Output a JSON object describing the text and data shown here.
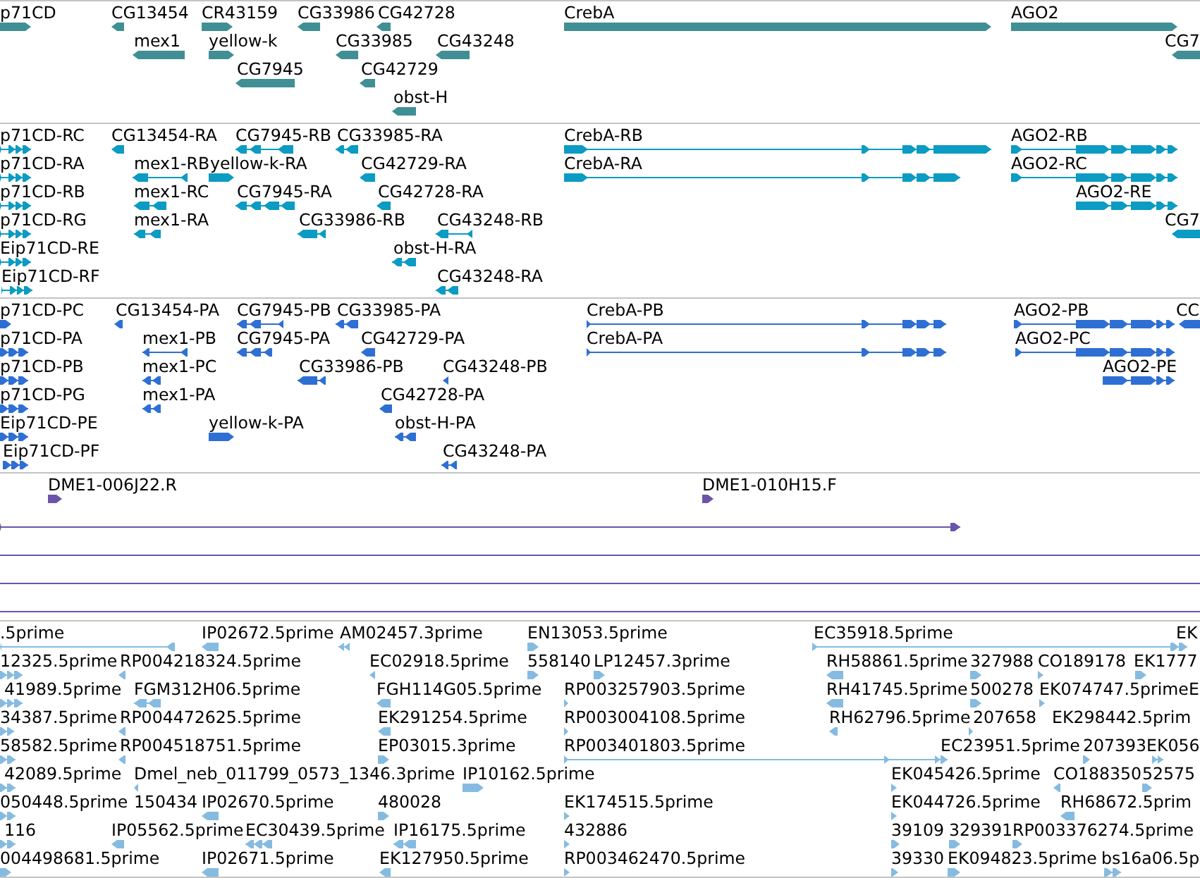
{
  "tracks": [
    {
      "kind": "gene",
      "features": [
        {
          "label": "p71CD",
          "reverse": false
        },
        {
          "label": "CG13454",
          "reverse": true
        },
        {
          "label": "CR43159",
          "reverse": false
        },
        {
          "label": "CG33986",
          "reverse": true
        },
        {
          "label": "CG42728",
          "reverse": true
        },
        {
          "label": "CrebA",
          "reverse": false
        },
        {
          "label": "AGO2",
          "reverse": false
        },
        {
          "label": "mex1",
          "reverse": true
        },
        {
          "label": "yellow-k",
          "reverse": false
        },
        {
          "label": "CG33985",
          "reverse": true
        },
        {
          "label": "CG43248",
          "reverse": true
        },
        {
          "label": "CG7",
          "reverse": true
        },
        {
          "label": "CG7945",
          "reverse": true
        },
        {
          "label": "CG42729",
          "reverse": true
        },
        {
          "label": "obst-H",
          "reverse": true
        }
      ]
    },
    {
      "kind": "transcript",
      "features": [
        {
          "label": "p71CD-RC",
          "reverse": false
        },
        {
          "label": "CG13454-RA",
          "reverse": true
        },
        {
          "label": "CG7945-RB",
          "reverse": true
        },
        {
          "label": "CG33985-RA",
          "reverse": true
        },
        {
          "label": "CrebA-RB",
          "reverse": false
        },
        {
          "label": "AGO2-RB",
          "reverse": false
        },
        {
          "label": "p71CD-RA",
          "reverse": false
        },
        {
          "label": "mex1-RB",
          "reverse": true
        },
        {
          "label": "yellow-k-RA",
          "reverse": false
        },
        {
          "label": "CG42729-RA",
          "reverse": true
        },
        {
          "label": "CrebA-RA",
          "reverse": false
        },
        {
          "label": "AGO2-RC",
          "reverse": false
        },
        {
          "label": "p71CD-RB",
          "reverse": false
        },
        {
          "label": "mex1-RC",
          "reverse": true
        },
        {
          "label": "CG7945-RA",
          "reverse": true
        },
        {
          "label": "CG42728-RA",
          "reverse": true
        },
        {
          "label": "AGO2-RE",
          "reverse": false
        },
        {
          "label": "p71CD-RG",
          "reverse": false
        },
        {
          "label": "mex1-RA",
          "reverse": true
        },
        {
          "label": "CG33986-RB",
          "reverse": true
        },
        {
          "label": "CG43248-RB",
          "reverse": true
        },
        {
          "label": "CG7",
          "reverse": true
        },
        {
          "label": "Eip71CD-RE",
          "reverse": false
        },
        {
          "label": "obst-H-RA",
          "reverse": true
        },
        {
          "label": "Eip71CD-RF",
          "reverse": false
        },
        {
          "label": "CG43248-RA",
          "reverse": true
        }
      ]
    },
    {
      "kind": "protein",
      "features": [
        {
          "label": "p71CD-PC",
          "reverse": false
        },
        {
          "label": "CG13454-PA",
          "reverse": true
        },
        {
          "label": "CG7945-PB",
          "reverse": true
        },
        {
          "label": "CG33985-PA",
          "reverse": true
        },
        {
          "label": "CrebA-PB",
          "reverse": false
        },
        {
          "label": "AGO2-PB",
          "reverse": false
        },
        {
          "label": "CC",
          "reverse": true
        },
        {
          "label": "p71CD-PA",
          "reverse": false
        },
        {
          "label": "mex1-PB",
          "reverse": true
        },
        {
          "label": "CG7945-PA",
          "reverse": true
        },
        {
          "label": "CG42729-PA",
          "reverse": true
        },
        {
          "label": "CrebA-PA",
          "reverse": false
        },
        {
          "label": "AGO2-PC",
          "reverse": false
        },
        {
          "label": "p71CD-PB",
          "reverse": false
        },
        {
          "label": "mex1-PC",
          "reverse": true
        },
        {
          "label": "CG33986-PB",
          "reverse": true
        },
        {
          "label": "CG43248-PB",
          "reverse": true
        },
        {
          "label": "AGO2-PE",
          "reverse": false
        },
        {
          "label": "p71CD-PG",
          "reverse": false
        },
        {
          "label": "mex1-PA",
          "reverse": true
        },
        {
          "label": "CG42728-PA",
          "reverse": true
        },
        {
          "label": "Eip71CD-PE",
          "reverse": false
        },
        {
          "label": "yellow-k-PA",
          "reverse": false
        },
        {
          "label": "obst-H-PA",
          "reverse": true
        },
        {
          "label": "Eip71CD-PF",
          "reverse": false
        },
        {
          "label": "CG43248-PA",
          "reverse": true
        }
      ]
    },
    {
      "kind": "clone",
      "features": [
        {
          "label": "DME1-006J22.R",
          "reverse": false
        },
        {
          "label": "DME1-010H15.F",
          "reverse": false
        },
        {
          "reverse": false
        }
      ]
    },
    {
      "kind": "est",
      "features": [
        {
          "label": ".5prime",
          "reverse": true
        },
        {
          "label": "IP02672.5prime",
          "reverse": true
        },
        {
          "label": "AM02457.3prime",
          "reverse": true
        },
        {
          "label": "EN13053.5prime",
          "reverse": false
        },
        {
          "label": "EC35918.5prime",
          "reverse": false
        },
        {
          "label": "EK"
        },
        {
          "label": "12325.5prime",
          "reverse": false
        },
        {
          "label": "RP004218324.5prime",
          "reverse": true
        },
        {
          "label": "EC02918.5prime",
          "reverse": true
        },
        {
          "label": "558140",
          "reverse": false
        },
        {
          "label": "LP12457.3prime",
          "reverse": false
        },
        {
          "label": "RH58861.5prime",
          "reverse": true
        },
        {
          "label": "327988",
          "reverse": false
        },
        {
          "label": "CO189178",
          "reverse": false
        },
        {
          "label": "EK1777",
          "reverse": false
        },
        {
          "label": "41989.5prime",
          "reverse": false
        },
        {
          "label": "FGM312H06.5prime",
          "reverse": true
        },
        {
          "label": "FGH114G05.5prime",
          "reverse": true
        },
        {
          "label": "RP003257903.5prime",
          "reverse": false
        },
        {
          "label": "RH41745.5prime",
          "reverse": true
        },
        {
          "label": "500278",
          "reverse": false
        },
        {
          "label": "EK074747.5prime",
          "reverse": false
        },
        {
          "label": "E"
        },
        {
          "label": "34387.5prime",
          "reverse": false
        },
        {
          "label": "RP004472625.5prime",
          "reverse": true
        },
        {
          "label": "EK291254.5prime",
          "reverse": true
        },
        {
          "label": "RP003004108.5prime",
          "reverse": false
        },
        {
          "label": "RH62796.5prime",
          "reverse": true
        },
        {
          "label": "207658",
          "reverse": false
        },
        {
          "label": "EK298442.5prim"
        },
        {
          "label": "58582.5prime",
          "reverse": false
        },
        {
          "label": "RP004518751.5prime",
          "reverse": true
        },
        {
          "label": "EP03015.3prime",
          "reverse": false
        },
        {
          "label": "RP003401803.5prime",
          "reverse": false
        },
        {
          "label": "EC23951.5prime"
        },
        {
          "label": "207393",
          "reverse": false
        },
        {
          "label": "EK056",
          "reverse": false
        },
        {
          "label": "42089.5prime",
          "reverse": false
        },
        {
          "label": "Dmel_neb_011799_0573_1346.3prime",
          "reverse": true
        },
        {
          "label": "IP10162.5prime",
          "reverse": false
        },
        {
          "label": "EK045426.5prime",
          "reverse": false
        },
        {
          "label": "CO188350",
          "reverse": true
        },
        {
          "label": "52575",
          "reverse": false
        },
        {
          "label": "050448.5prime",
          "reverse": false
        },
        {
          "label": "150434"
        },
        {
          "label": "IP02670.5prime",
          "reverse": true
        },
        {
          "label": "480028",
          "reverse": false
        },
        {
          "label": "EK174515.5prime",
          "reverse": false
        },
        {
          "label": "EK044726.5prime",
          "reverse": false
        },
        {
          "label": "RH68672.5prim",
          "reverse": true
        },
        {
          "label": "116",
          "reverse": false
        },
        {
          "label": "IP05562.5prime",
          "reverse": true
        },
        {
          "label": "EC30439.5prime",
          "reverse": true
        },
        {
          "label": "IP16175.5prime",
          "reverse": true
        },
        {
          "label": "432886",
          "reverse": false
        },
        {
          "label": "39109",
          "reverse": false
        },
        {
          "label": "329391",
          "reverse": false
        },
        {
          "label": "RP003376274.5prime",
          "reverse": false
        },
        {
          "label": "004498681.5prime",
          "reverse": false
        },
        {
          "label": "IP02671.5prime",
          "reverse": true
        },
        {
          "label": "EK127950.5prime",
          "reverse": true
        },
        {
          "label": "RP003462470.5prime",
          "reverse": false
        },
        {
          "label": "39330",
          "reverse": false
        },
        {
          "label": "EK094823.5prime",
          "reverse": false
        },
        {
          "label": "bs16a06.5p",
          "reverse": false
        }
      ]
    }
  ]
}
